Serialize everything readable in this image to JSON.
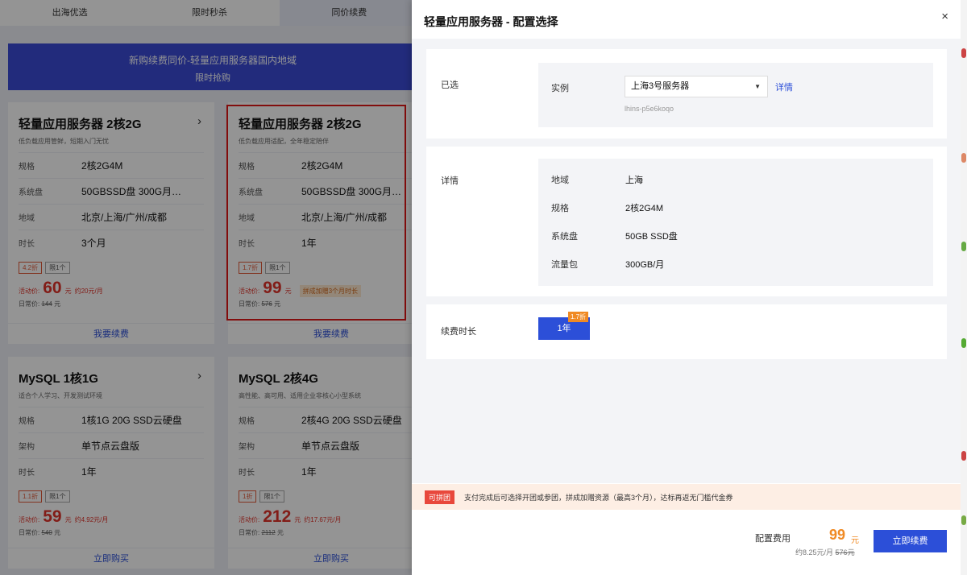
{
  "background": {
    "tabs": [
      "出海优选",
      "限时秒杀",
      "同价续费"
    ],
    "banner": {
      "title": "新购续费同价-轻量应用服务器国内地域",
      "subtitle": "限时抢购"
    },
    "cards": [
      {
        "name": "轻量应用服务器 2核2G",
        "chevron": "›",
        "desc": "低负载应用管鲜，短期入门无忧",
        "rows": [
          [
            "规格",
            "2核2G4M"
          ],
          [
            "系统盘",
            "50GBSSD盘 300G月…"
          ],
          [
            "地域",
            "北京/上海/广州/成都"
          ],
          [
            "时长",
            "3个月"
          ]
        ],
        "discount": "4.2折",
        "limit": "限1个",
        "price_label": "活动价:",
        "price": "60",
        "price_unit": "元",
        "per_month": "约20元/月",
        "badge": "",
        "daily_label": "日常价:",
        "daily": "144",
        "daily_unit": "元",
        "action": "我要续费"
      },
      {
        "name": "轻量应用服务器 2核2G",
        "chevron": "",
        "desc": "低负载应用适配，全年稳定陪伴",
        "rows": [
          [
            "规格",
            "2核2G4M"
          ],
          [
            "系统盘",
            "50GBSSD盘 300G月…"
          ],
          [
            "地域",
            "北京/上海/广州/成都"
          ],
          [
            "时长",
            "1年"
          ]
        ],
        "discount": "1.7折",
        "limit": "限1个",
        "price_label": "活动价:",
        "price": "99",
        "price_unit": "元",
        "per_month": "",
        "badge": "拼成加赠3个月时长",
        "daily_label": "日常价:",
        "daily": "576",
        "daily_unit": "元",
        "action": "我要续费"
      },
      {
        "name": "MySQL 1核1G",
        "chevron": "›",
        "desc": "适合个人学习、开发测试环境",
        "rows": [
          [
            "规格",
            "1核1G 20G SSD云硬盘"
          ],
          [
            "架构",
            "单节点云盘版"
          ],
          [
            "时长",
            "1年"
          ]
        ],
        "discount": "1.1折",
        "limit": "限1个",
        "price_label": "活动价:",
        "price": "59",
        "price_unit": "元",
        "per_month": "约4.92元/月",
        "badge": "",
        "daily_label": "日常价:",
        "daily": "540",
        "daily_unit": "元",
        "action": "立即购买"
      },
      {
        "name": "MySQL 2核4G",
        "chevron": "",
        "desc": "高性能、高可用、适用企业非核心小型系统",
        "rows": [
          [
            "规格",
            "2核4G 20G SSD云硬盘"
          ],
          [
            "架构",
            "单节点云盘版"
          ],
          [
            "时长",
            "1年"
          ]
        ],
        "discount": "1折",
        "limit": "限1个",
        "price_label": "活动价:",
        "price": "212",
        "price_unit": "元",
        "per_month": "约17.67元/月",
        "badge": "",
        "daily_label": "日常价:",
        "daily": "2112",
        "daily_unit": "元",
        "action": "立即购买"
      }
    ]
  },
  "drawer": {
    "title": "轻量应用服务器 - 配置选择",
    "close": "×",
    "selected": {
      "label": "已选",
      "instance_label": "实例",
      "instance_value": "上海3号服务器",
      "detail_link": "详情",
      "instance_id": "lhins-p5e6koqo"
    },
    "details": {
      "label": "详情",
      "rows": [
        {
          "k": "地域",
          "v": "上海"
        },
        {
          "k": "规格",
          "v": "2核2G4M"
        },
        {
          "k": "系统盘",
          "v": "50GB SSD盘"
        },
        {
          "k": "流量包",
          "v": "300GB/月"
        }
      ]
    },
    "duration": {
      "label": "续费时长",
      "option": "1年",
      "badge": "1.7折"
    },
    "notice": {
      "tag": "可拼团",
      "text": "支付完成后可选择开团或参团，拼成加赠资源（最高3个月），达标再返无门槛代金券"
    },
    "footer": {
      "fee_label": "配置费用",
      "price": "99",
      "unit": "元",
      "per_month": "约8.25元/月",
      "original": "576元",
      "button": "立即续费"
    }
  },
  "colors": {
    "accent": "#2c4fd8",
    "price": "#f08a24",
    "highlight": "#e01818"
  }
}
